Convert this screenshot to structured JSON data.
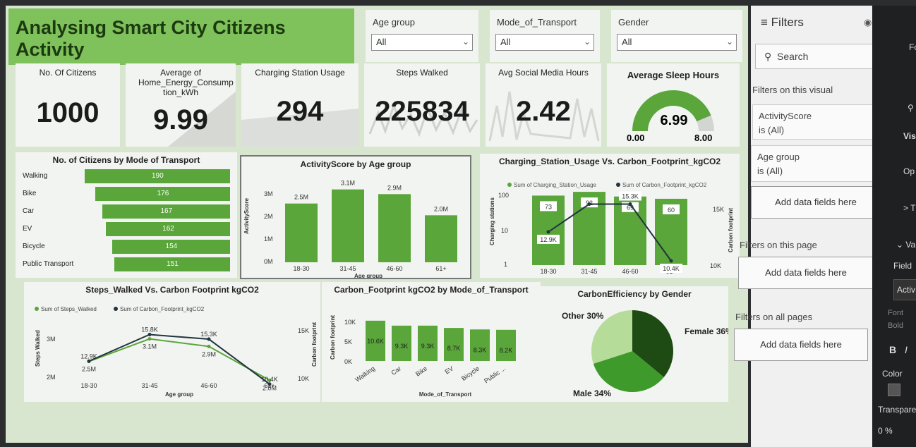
{
  "title": "Analysing Smart City Citizens Activity",
  "slicers": [
    {
      "label": "Age group",
      "value": "All"
    },
    {
      "label": "Mode_of_Transport",
      "value": "All"
    },
    {
      "label": "Gender",
      "value": "All"
    }
  ],
  "kpis": {
    "citizens": {
      "label": "No. Of Citizens",
      "value": "1000"
    },
    "energy": {
      "label": "Average of Home_Energy_Consump tion_kWh",
      "value": "9.99"
    },
    "charging": {
      "label": "Charging Station Usage",
      "value": "294"
    },
    "steps": {
      "label": "Steps Walked",
      "value": "225834"
    },
    "social": {
      "label": "Avg Social Media Hours",
      "value": "2.42"
    },
    "sleep": {
      "label": "Average Sleep Hours",
      "value": "6.99",
      "min": "0.00",
      "max": "8.00",
      "fraction": 0.874
    }
  },
  "chart_data": [
    {
      "type": "bar",
      "title": "No. of Citizens by Mode of Transport",
      "orientation": "horizontal",
      "categories": [
        "Walking",
        "Bike",
        "Car",
        "EV",
        "Bicycle",
        "Public Transport"
      ],
      "values": [
        190,
        176,
        167,
        162,
        154,
        151
      ],
      "labels": [
        "190",
        "176",
        "167",
        "162",
        "154",
        "151"
      ]
    },
    {
      "type": "bar",
      "title": "ActivityScore by Age group",
      "xlabel": "Age group",
      "ylabel": "ActivityScore",
      "categories": [
        "18-30",
        "31-45",
        "46-60",
        "61+"
      ],
      "values": [
        2500000,
        3100000,
        2900000,
        2000000
      ],
      "labels": [
        "2.5M",
        "3.1M",
        "2.9M",
        "2.0M"
      ],
      "yticks": [
        "3M",
        "2M",
        "1M",
        "0M"
      ],
      "ylim": [
        0,
        3300000
      ]
    },
    {
      "type": "bar",
      "title": "Charging_Station_Usage Vs. Carbon_Footprint_kgCO2",
      "xlabel": "Age group",
      "ylabel": "Charging stations",
      "y2label": "Carbon footprint",
      "categories": [
        "18-30",
        "31-45",
        "46-60",
        "61+"
      ],
      "yticks": [
        "100",
        "10",
        "1"
      ],
      "y2ticks": [
        "15K",
        "10K"
      ],
      "series": [
        {
          "name": "Sum of Charging_Station_Usage",
          "values": [
            73,
            92,
            69,
            60
          ],
          "labels": [
            "73",
            "92",
            "69",
            "60"
          ]
        },
        {
          "name": "Sum of Carbon_Footprint_kgCO2",
          "values": [
            12900,
            15300,
            15300,
            10400
          ],
          "labels": [
            "12.9K",
            "",
            "15.3K",
            "10.4K"
          ]
        }
      ]
    },
    {
      "type": "line",
      "title": "Steps_Walked Vs. Carbon Footprint kgCO2",
      "xlabel": "Age group",
      "ylabel": "Steps Walked",
      "y2label": "Carbon footprint",
      "categories": [
        "18-30",
        "31-45",
        "46-60",
        "61+"
      ],
      "yticks": [
        "3M",
        "2M"
      ],
      "y2ticks": [
        "15K",
        "10K"
      ],
      "series": [
        {
          "name": "Sum of Steps_Walked",
          "values": [
            2500000,
            3100000,
            2900000,
            2000000
          ],
          "labels": [
            "2.5M",
            "3.1M",
            "2.9M",
            "2.0M"
          ]
        },
        {
          "name": "Sum of Carbon_Footprint_kgCO2",
          "values": [
            12900,
            15800,
            15300,
            10400
          ],
          "labels": [
            "12.9K",
            "15.8K",
            "15.3K",
            "10.4K"
          ]
        }
      ]
    },
    {
      "type": "bar",
      "title": "Carbon_Footprint kgCO2 by Mode_of_Transport",
      "xlabel": "Mode_of_Transport",
      "ylabel": "Carbon footprint",
      "categories": [
        "Walking",
        "Car",
        "Bike",
        "EV",
        "Bicycle",
        "Public ..."
      ],
      "values": [
        10600,
        9300,
        9300,
        8700,
        8300,
        8200
      ],
      "labels": [
        "10.6K",
        "9.3K",
        "9.3K",
        "8.7K",
        "8.3K",
        "8.2K"
      ],
      "yticks": [
        "10K",
        "5K",
        "0K"
      ],
      "ylim": [
        0,
        11500
      ]
    },
    {
      "type": "pie",
      "title": "CarbonEfficiency by Gender",
      "categories": [
        "Female",
        "Male",
        "Other"
      ],
      "values": [
        36,
        34,
        30
      ],
      "labels": [
        "Female 36%",
        "Male 34%",
        "Other 30%"
      ],
      "colors": [
        "#1e4a14",
        "#3f9a2c",
        "#b6dc9a"
      ]
    }
  ],
  "filters_pane": {
    "title": "Filters",
    "search_placeholder": "Search",
    "on_visual": "Filters on this visual",
    "f1_name": "ActivityScore",
    "f1_value": "is (All)",
    "f2_name": "Age group",
    "f2_value": "is (All)",
    "add1": "Add data fields here",
    "on_page": "Filters on this page",
    "add2": "Add data fields here",
    "on_all": "Filters on all pages",
    "add3": "Add data fields here"
  },
  "format_pane": {
    "a": "Fo",
    "b": "Vis",
    "c": "Op",
    "d": "> T",
    "e": "Va",
    "field": "Field",
    "acti": "Activ",
    "font": "Font",
    "bold": "Bold",
    "b_btn": "B",
    "i_btn": "I",
    "color": "Color",
    "transp": "Transparen",
    "transp_val": "0 %"
  },
  "colors": {
    "accent": "#5aa63a",
    "title_bg": "#7fc15a",
    "line_dark": "#22343f"
  }
}
